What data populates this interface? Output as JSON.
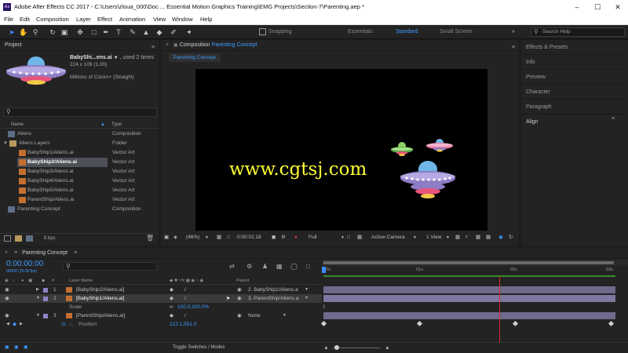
{
  "window": {
    "title": "Adobe After Effects CC 2017 - C:\\Users\\zloua_000\\Doc ... Essential Motion Graphics Training\\EMG Projects\\Section-7\\Parenting.aep *",
    "app_icon": "Ae"
  },
  "menu": [
    "File",
    "Edit",
    "Composition",
    "Layer",
    "Effect",
    "Animation",
    "View",
    "Window",
    "Help"
  ],
  "toolbar": {
    "snapping_label": "Snapping",
    "workspaces": [
      "Essentials",
      "Standard",
      "Small Screen"
    ],
    "active_workspace": "Standard",
    "search_placeholder": "Search Help"
  },
  "project": {
    "title": "Project",
    "selected_name": "BabyShi...ens.ai",
    "used": ", used 2 times",
    "dimensions": "224 x 109 (1.00)",
    "colors": "Millions of Colors+ (Straight)",
    "col_name": "Name",
    "col_type": "Type",
    "items": [
      {
        "name": "Aliens",
        "type": "Composition",
        "kind": "comp",
        "indent": 0,
        "selected": false
      },
      {
        "name": "Aliens Layers",
        "type": "Folder",
        "kind": "folder",
        "indent": 0,
        "selected": false
      },
      {
        "name": "BabyShip1/Aliens.ai",
        "type": "Vector Art",
        "kind": "ai",
        "indent": 1,
        "selected": false
      },
      {
        "name": "BabyShip2/Aliens.ai",
        "type": "Vector Art",
        "kind": "ai",
        "indent": 1,
        "selected": true
      },
      {
        "name": "BabyShip3/Aliens.ai",
        "type": "Vector Art",
        "kind": "ai",
        "indent": 1,
        "selected": false
      },
      {
        "name": "BabyShip4/Aliens.ai",
        "type": "Vector Art",
        "kind": "ai",
        "indent": 1,
        "selected": false
      },
      {
        "name": "BabyShip5/Aliens.ai",
        "type": "Vector Art",
        "kind": "ai",
        "indent": 1,
        "selected": false
      },
      {
        "name": "ParentShip/Aliens.ai",
        "type": "Vector Art",
        "kind": "ai",
        "indent": 1,
        "selected": false
      },
      {
        "name": "Parenting Concept",
        "type": "Composition",
        "kind": "comp",
        "indent": 0,
        "selected": false
      }
    ],
    "bpc": "8 bpc"
  },
  "composition": {
    "panel_label": "Composition",
    "panel_name": "Parenting Concept",
    "tab": "Parenting Concept",
    "watermark": "www.cgtsj.com",
    "zoom": "(46%)",
    "timecode": "0:00:01:18",
    "resolution": "Full",
    "camera": "Active Camera",
    "views": "1 View"
  },
  "right_panels": [
    "Effects & Presets",
    "Info",
    "Preview",
    "Character",
    "Paragraph",
    "Align"
  ],
  "timeline": {
    "tab": "Parenting Concept",
    "timecode": "0:00:00:00",
    "frames": "00000 (25.00 fps)",
    "col_layer": "Layer Name",
    "col_parent": "Parent",
    "ruler": [
      "00s",
      "01s",
      "02s",
      "03s"
    ],
    "layers": [
      {
        "num": "1",
        "name": "[BabyShip2/Aliens.ai]",
        "parent": "2. BabyShip1/Aliens.a",
        "selected": false
      },
      {
        "num": "2",
        "name": "[BabyShip1/Aliens.ai]",
        "parent": "3. ParentShip/Aliens.a",
        "selected": true
      },
      {
        "num": "3",
        "name": "[ParentShip/Aliens.ai]",
        "parent": "None",
        "selected": false
      }
    ],
    "scale_label": "Scale",
    "scale_value": "100.0,100.0%",
    "position_label": "Position",
    "position_value": "212.1,551.0",
    "toggle_label": "Toggle Switches / Modes",
    "playhead_seconds": 1.84
  },
  "colors": {
    "accent_blue": "#3d8cff",
    "watermark": "#ffff33",
    "layer_bar": "#6f6b8c",
    "work_area": "#3a8a2e",
    "playhead": "#e0262a"
  }
}
